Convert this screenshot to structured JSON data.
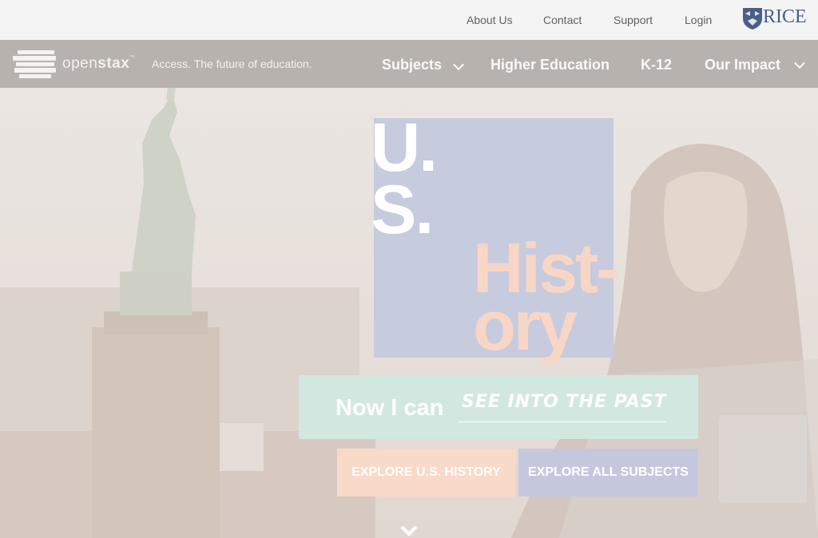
{
  "topbar": {
    "links": [
      "About Us",
      "Contact",
      "Support",
      "Login"
    ],
    "rice_logo_text": "RICE"
  },
  "nav": {
    "logo_text_light": "open",
    "logo_text_bold": "stax",
    "logo_tm": "™",
    "tagline": "Access. The future of education.",
    "items": [
      {
        "label": "Subjects",
        "has_dropdown": true
      },
      {
        "label": "Higher Education",
        "has_dropdown": false
      },
      {
        "label": "K-12",
        "has_dropdown": false
      },
      {
        "label": "Our Impact",
        "has_dropdown": true
      }
    ]
  },
  "hero": {
    "title_line1": "U.",
    "title_line2": "S.",
    "title_line3": "Hist-",
    "title_line4": "ory",
    "now_i_can": "Now I can",
    "now_i_can_phrase": "SEE INTO THE PAST",
    "buttons": {
      "explore_history": "EXPLORE U.S. HISTORY",
      "explore_all": "EXPLORE ALL SUBJECTS"
    }
  },
  "colors": {
    "nav_bg": "#b7b2ae",
    "title_box": "#c7cbde",
    "history_text": "#f8d6c6",
    "now_i_can_bg": "#d3e7e1",
    "btn_history": "#f9d9c8",
    "btn_subjects": "#c5c8dc",
    "rice_blue": "#4a5f87"
  },
  "icons": [
    "rice-shield-icon",
    "openstax-books-icon",
    "chevron-down-icon",
    "scroll-down-chevron-icon"
  ]
}
